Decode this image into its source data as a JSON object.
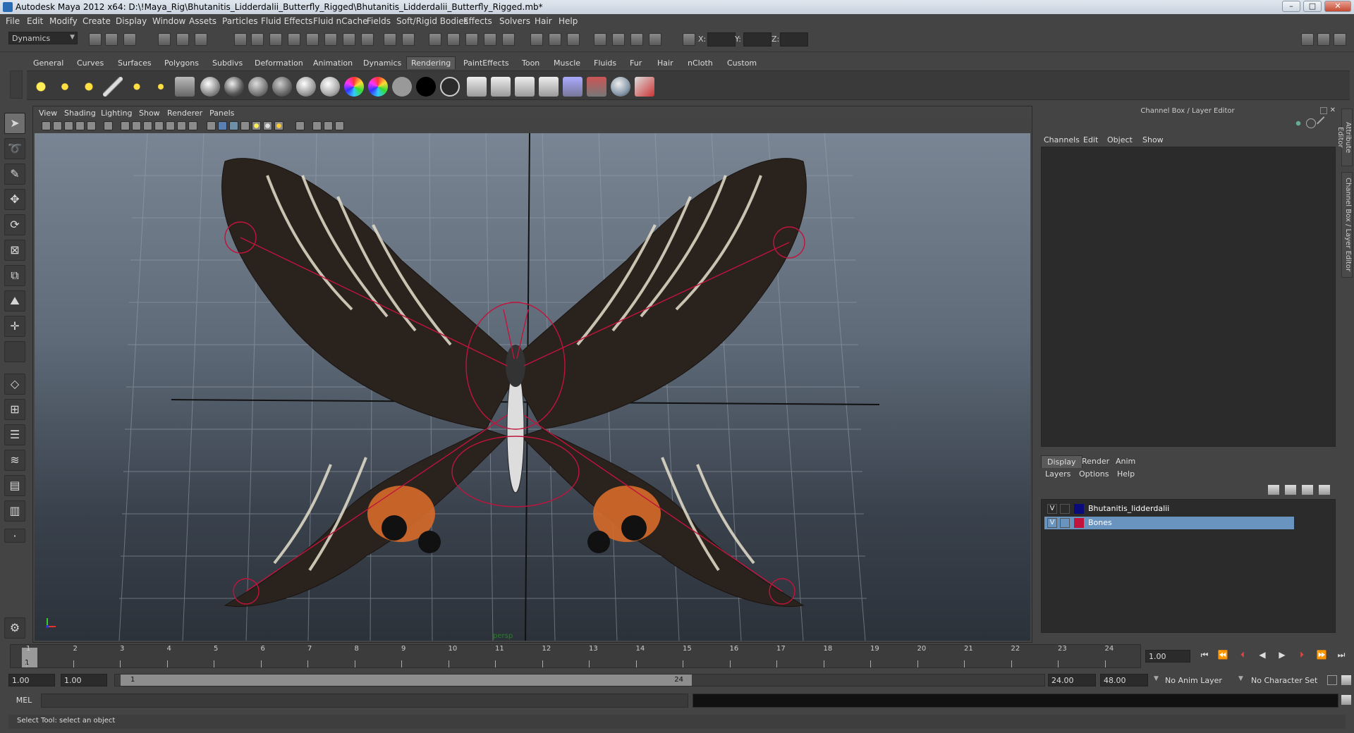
{
  "window": {
    "title": "Autodesk Maya 2012 x64: D:\\!Maya_Rig\\Bhutanitis_Lidderdalii_Butterfly_Rigged\\Bhutanitis_Lidderdalii_Butterfly_Rigged.mb*",
    "buttons": [
      "–",
      "□",
      "✕"
    ]
  },
  "menubar": [
    "File",
    "Edit",
    "Modify",
    "Create",
    "Display",
    "Window",
    "Assets",
    "Particles",
    "Fluid Effects",
    "Fluid nCache",
    "Fields",
    "Soft/Rigid Bodies",
    "Effects",
    "Solvers",
    "Hair",
    "Help"
  ],
  "status_line": {
    "menu_set": "Dynamics",
    "x_label": "X:",
    "y_label": "Y:",
    "z_label": "Z:"
  },
  "shelf": {
    "tabs": [
      "General",
      "Curves",
      "Surfaces",
      "Polygons",
      "Subdivs",
      "Deformation",
      "Animation",
      "Dynamics",
      "Rendering",
      "PaintEffects",
      "Toon",
      "Muscle",
      "Fluids",
      "Fur",
      "Hair",
      "nCloth",
      "Custom"
    ],
    "active_tab": "Rendering"
  },
  "viewport": {
    "menu": [
      "View",
      "Shading",
      "Lighting",
      "Show",
      "Renderer",
      "Panels"
    ],
    "camera_label": "persp"
  },
  "channel_box": {
    "title": "Channel Box / Layer Editor",
    "menu": [
      "Channels",
      "Edit",
      "Object",
      "Show"
    ]
  },
  "layer_editor": {
    "tabs": [
      "Display",
      "Render",
      "Anim"
    ],
    "active_tab": "Display",
    "menu": [
      "Layers",
      "Options",
      "Help"
    ],
    "layers": [
      {
        "visible": "V",
        "name": "Bhutanitis_lidderdalii",
        "color": "#0a0a7a",
        "selected": false
      },
      {
        "visible": "V",
        "name": "Bones",
        "color": "#c0143c",
        "selected": true
      }
    ]
  },
  "side_tabs": [
    "Attribute Editor",
    "Channel Box / Layer Editor"
  ],
  "time_slider": {
    "ticks": [
      "1",
      "2",
      "3",
      "4",
      "5",
      "6",
      "7",
      "8",
      "9",
      "10",
      "11",
      "12",
      "13",
      "14",
      "15",
      "16",
      "17",
      "18",
      "19",
      "20",
      "21",
      "22",
      "23",
      "24"
    ],
    "current_frame": "1",
    "current_time": "1.00"
  },
  "range_slider": {
    "start_time": "1.00",
    "start_range": "1.00",
    "range_start_label": "1",
    "range_end_label": "24",
    "end_range": "24.00",
    "end_time": "48.00",
    "anim_layer": "No Anim Layer",
    "character_set": "No Character Set"
  },
  "command_line": {
    "label": "MEL"
  },
  "help_line": {
    "text": "Select Tool: select an object"
  }
}
